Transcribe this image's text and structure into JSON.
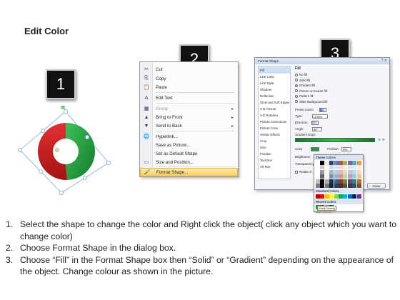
{
  "title": "Edit Color",
  "badges": [
    "1",
    "2",
    "3"
  ],
  "context_menu": {
    "items": [
      {
        "icon": "✂",
        "label": "Cut",
        "ul": "t",
        "disabled": false,
        "submenu": false
      },
      {
        "icon": "⎘",
        "label": "Copy",
        "disabled": false,
        "submenu": false
      },
      {
        "icon": "📋",
        "label": "Paste",
        "disabled": false,
        "submenu": false
      },
      {
        "icon": "A",
        "label": "Edit Text",
        "disabled": false,
        "submenu": false
      },
      {
        "icon": "▦",
        "label": "Group",
        "disabled": true,
        "submenu": true
      },
      {
        "icon": "▲",
        "label": "Bring to Front",
        "disabled": false,
        "submenu": true
      },
      {
        "icon": "▼",
        "label": "Send to Back",
        "disabled": false,
        "submenu": true
      },
      {
        "icon": "🌐",
        "label": "Hyperlink...",
        "disabled": false,
        "submenu": false
      },
      {
        "icon": "",
        "label": "Save as Picture...",
        "disabled": false,
        "submenu": false
      },
      {
        "icon": "",
        "label": "Set as Default Shape",
        "disabled": false,
        "submenu": false
      },
      {
        "icon": "▭",
        "label": "Size and Position...",
        "disabled": false,
        "submenu": false
      },
      {
        "icon": "🖌",
        "label": "Format Shape...",
        "disabled": false,
        "submenu": false,
        "selected": true
      }
    ]
  },
  "format_dialog": {
    "title": "Format Shape",
    "categories": [
      "Fill",
      "Line Color",
      "Line Style",
      "Shadow",
      "Reflection",
      "Glow and Soft Edges",
      "3-D Format",
      "3-D Rotation",
      "Picture Corrections",
      "Picture Color",
      "Artistic Effects",
      "Crop",
      "Size",
      "Position",
      "Text Box",
      "Alt Text"
    ],
    "selected_category": "Fill",
    "fill_heading": "Fill",
    "fill_options": [
      "No fill",
      "Solid fill",
      "Gradient fill",
      "Picture or texture fill",
      "Pattern fill",
      "Slide background fill"
    ],
    "selected_fill": "Gradient fill",
    "preset_colors_label": "Preset colors:",
    "type_label": "Type:",
    "type_value": "Linear",
    "direction_label": "Direction:",
    "angle_label": "Angle:",
    "angle_value": "30°",
    "gradient_stops_label": "Gradient stops",
    "color_label": "Color",
    "position_label": "Position:",
    "position_value": "0%",
    "brightness_label": "Brightness:",
    "transparency_label": "Transparency:",
    "rotate_label": "Rotate w",
    "close_label": "Close"
  },
  "color_popup": {
    "theme_colors_label": "Theme Colors",
    "standard_colors_label": "Standard Colors",
    "recent_colors_label": "Recent Colors",
    "more_colors_label": "More Colors...",
    "tooltip": "(Dark Green)"
  },
  "colors": {
    "donut_red": "#d11e1e",
    "donut_green": "#1f9d3a",
    "gradient_bar": "#1aa33a",
    "menu_highlight": "#f8cf62"
  },
  "steps": [
    {
      "num": "1.",
      "text": "Select the shape to change the color and Right click the object( click any object which you want to change color)"
    },
    {
      "num": "2.",
      "text": "Choose Format Shape in the dialog box."
    },
    {
      "num": "3.",
      "text": "Choose “Fill” in the Format Shape box then “Solid” or “Gradient” depending on the appearance of the object. Change colour as shown in the picture."
    }
  ]
}
